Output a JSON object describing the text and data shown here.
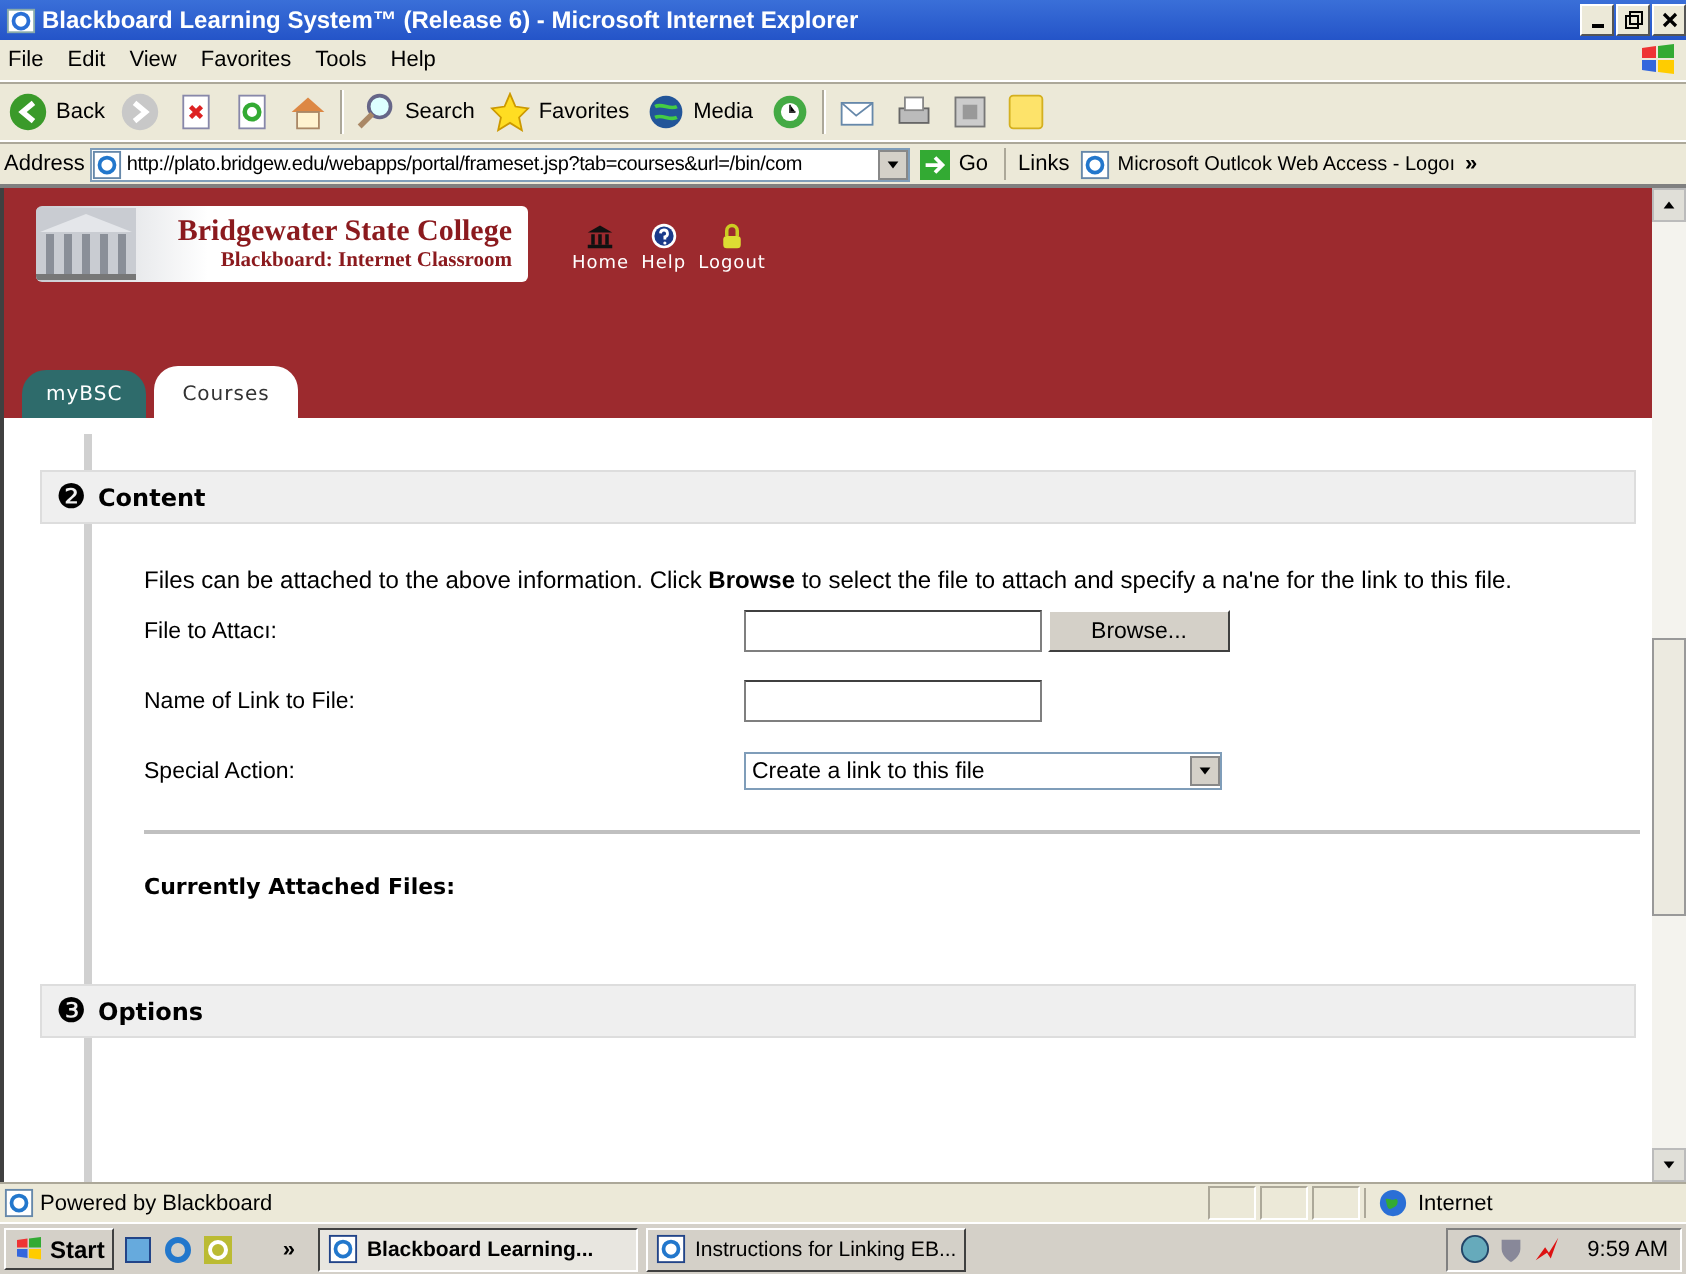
{
  "window": {
    "title": "Blackboard Learning System™ (Release 6) - Microsoft Internet Explorer"
  },
  "menu": [
    "File",
    "Edit",
    "View",
    "Favorites",
    "Tools",
    "Help"
  ],
  "toolbar": [
    {
      "kind": "back",
      "label": "Back"
    },
    {
      "kind": "forward"
    },
    {
      "kind": "stop"
    },
    {
      "kind": "refresh"
    },
    {
      "kind": "home"
    },
    {
      "kind": "search",
      "label": "Search"
    },
    {
      "kind": "favorites",
      "label": "Favorites"
    },
    {
      "kind": "media",
      "label": "Media"
    },
    {
      "kind": "history"
    },
    {
      "kind": "mail"
    },
    {
      "kind": "print"
    },
    {
      "kind": "edit"
    },
    {
      "kind": "note"
    }
  ],
  "address": {
    "label": "Address",
    "value": "http://plato.bridgew.edu/webapps/portal/frameset.jsp?tab=courses&url=/bin/com",
    "go": "Go",
    "links_label": "Links",
    "link": "Microsoft Outlcok Web Access - Logoı",
    "more": "»"
  },
  "banner": {
    "college": "Bridgewater State College",
    "subtitle": "Blackboard: Internet Classroom",
    "nav": [
      {
        "kind": "home",
        "label": "Home"
      },
      {
        "kind": "help",
        "label": "Help"
      },
      {
        "kind": "logout",
        "label": "Logout"
      }
    ]
  },
  "tabs": [
    {
      "label": "myBSC",
      "selected": false
    },
    {
      "label": "Courses",
      "selected": true
    }
  ],
  "sections": [
    {
      "number": "❷",
      "title": "Content"
    },
    {
      "number": "❸",
      "title": "Options"
    }
  ],
  "content": {
    "intro": "Files can be attached to the above information. Click **Browse** to select the file to attach and specify a na'ne for the link to this file.",
    "fields": [
      {
        "kind": "file",
        "label": "File to Attacı:",
        "button": "Browse..."
      },
      {
        "kind": "text",
        "label": "Name of Link to File:"
      },
      {
        "kind": "select",
        "label": "Special Action:",
        "value": "Create a link to this file"
      }
    ],
    "attached_label": "Currently Attached Files:"
  },
  "status_bar": {
    "text": "Powered by Blackboard",
    "zone": "Internet"
  },
  "taskbar": {
    "start": "Start",
    "more": "»",
    "tasks": [
      {
        "label": "Blackboard Learning...",
        "selected": true
      },
      {
        "label": "Instructions for Linking EB...",
        "selected": false
      }
    ],
    "time": "9:59 AM"
  }
}
